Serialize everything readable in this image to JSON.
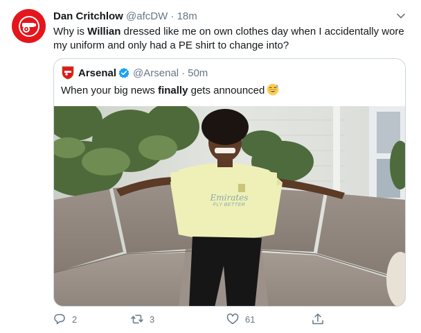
{
  "author": {
    "name": "Dan Critchlow",
    "handle": "@afcDW",
    "separator": "·",
    "time": "18m"
  },
  "tweet_text": {
    "part1": "Why is ",
    "bold": "Willian",
    "part2": " dressed like me on own clothes day when I accidentally wore my uniform and only had a PE shirt to change into?"
  },
  "quoted": {
    "name": "Arsenal",
    "handle": "@Arsenal",
    "separator": "·",
    "time": "50m",
    "text_part1": "When your big news ",
    "text_bold": "finally",
    "text_part2": " gets announced"
  },
  "photo_text": {
    "shirt_sponsor": "Emirates",
    "shirt_slogan": "FLY BETTER"
  },
  "actions": {
    "reply_count": "2",
    "retweet_count": "3",
    "like_count": "61"
  },
  "colors": {
    "brand_red": "#e4161c",
    "muted": "#657786",
    "verified_blue": "#1da1f2",
    "border": "#ccd6dd"
  }
}
